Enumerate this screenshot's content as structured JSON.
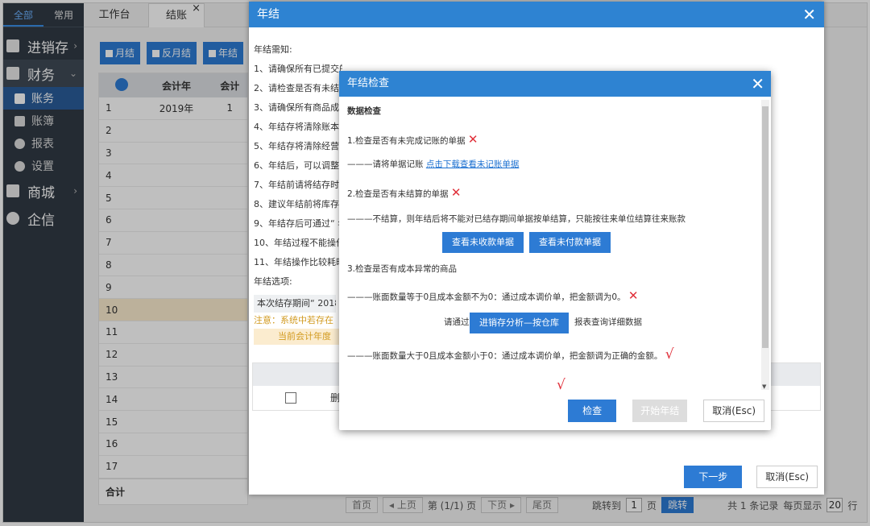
{
  "sidebar": {
    "tabs": [
      "全部",
      "常用"
    ],
    "items": [
      {
        "label": "进销存",
        "icon": "document-icon",
        "arrow": "›"
      },
      {
        "label": "财务",
        "icon": "briefcase-icon",
        "arrow": "⌄"
      },
      {
        "label": "账务",
        "icon": "ledger-icon",
        "sub": true,
        "active": true
      },
      {
        "label": "账簿",
        "icon": "book-icon",
        "sub": true
      },
      {
        "label": "报表",
        "icon": "pie-chart-icon",
        "sub": true
      },
      {
        "label": "设置",
        "icon": "gear-icon",
        "sub": true
      },
      {
        "label": "商城",
        "icon": "shop-icon",
        "arrow": "›"
      },
      {
        "label": "企信",
        "icon": "chat-icon"
      }
    ]
  },
  "tabs": {
    "workbench": "工作台",
    "closing": "结账",
    "close_mark": "×"
  },
  "toolbar": {
    "monthly": "月结",
    "reverse_monthly": "反月结",
    "yearly": "年结"
  },
  "grid": {
    "col_year": "会计年",
    "col_extra": "会计",
    "rows": [
      {
        "n": "1",
        "year": "2019年",
        "extra": "1"
      },
      {
        "n": "2",
        "year": "",
        "extra": ""
      },
      {
        "n": "3",
        "year": "",
        "extra": ""
      },
      {
        "n": "4",
        "year": "",
        "extra": ""
      },
      {
        "n": "5",
        "year": "",
        "extra": ""
      },
      {
        "n": "6",
        "year": "",
        "extra": ""
      },
      {
        "n": "7",
        "year": "",
        "extra": ""
      },
      {
        "n": "8",
        "year": "",
        "extra": ""
      },
      {
        "n": "9",
        "year": "",
        "extra": ""
      },
      {
        "n": "10",
        "year": "",
        "extra": ""
      },
      {
        "n": "11",
        "year": "",
        "extra": ""
      },
      {
        "n": "12",
        "year": "",
        "extra": ""
      },
      {
        "n": "13",
        "year": "",
        "extra": ""
      },
      {
        "n": "14",
        "year": "",
        "extra": ""
      },
      {
        "n": "15",
        "year": "",
        "extra": ""
      },
      {
        "n": "16",
        "year": "",
        "extra": ""
      },
      {
        "n": "17",
        "year": "",
        "extra": ""
      }
    ],
    "total": "合计"
  },
  "pager": {
    "first": "首页",
    "prev": "◂ 上页",
    "page": "第 (1/1) 页",
    "next": "下页 ▸",
    "last": "尾页",
    "jump_label": "跳转到",
    "jump_value": "1",
    "page_unit": "页",
    "jump_btn": "跳转",
    "summary": "共 1 条记录",
    "per_page_label": "每页显示",
    "per_page": "20",
    "row_unit": "行"
  },
  "year_end_dialog": {
    "title": "年结",
    "notice_title": "年结需知:",
    "notices": [
      "1、请确保所有已提交的单据已记账完成",
      "2、请检查是否有未结算",
      "3、请确保所有商品成本",
      "4、年结存将清除账本",
      "5、年结存将清除经营",
      "6、年结后，可以调整",
      "7、年结前请将结存时间",
      "8、建议年结前将库存",
      "9、年结存后可通过“ 年",
      "10、年结过程不能操作",
      "11、年结操作比较耗时"
    ],
    "options_label": "年结选项:",
    "period_label": "本次结存期间“ 2018",
    "warning": "注意：系统中若存在",
    "current_year": "当前会计年度",
    "delete_col": "删",
    "next_btn": "下一步",
    "cancel_btn": "取消(Esc)",
    "close": "✕"
  },
  "check_dialog": {
    "title": "年结检查",
    "close": "✕",
    "section": "数据检查",
    "item1": "1.检查是否有未完成记账的单据",
    "item1_tip": "———请将单据记账",
    "item1_link": "点击下载查看未记账单据",
    "item2": "2.检查是否有未结算的单据",
    "item2_tip": "———不结算，则年结后将不能对已结存期间单据按单结算，只能按往来单位结算往来账款",
    "btn_receivable": "查看未收款单据",
    "btn_payable": "查看未付款单据",
    "item3": "3.检查是否有成本异常的商品",
    "item3_tip1": "———账面数量等于0且成本金额不为0：通过成本调价单，把金额调为0。",
    "via_label": "请通过",
    "btn_inventory": "进销存分析—按仓库",
    "via_suffix": "报表查询详细数据",
    "item3_tip2": "———账面数量大于0且成本金额小于0：通过成本调价单，把金额调为正确的金额。",
    "mark_x": "✕",
    "mark_v": "√",
    "btn_check": "检查",
    "btn_start": "开始年结",
    "btn_cancel": "取消(Esc)"
  }
}
